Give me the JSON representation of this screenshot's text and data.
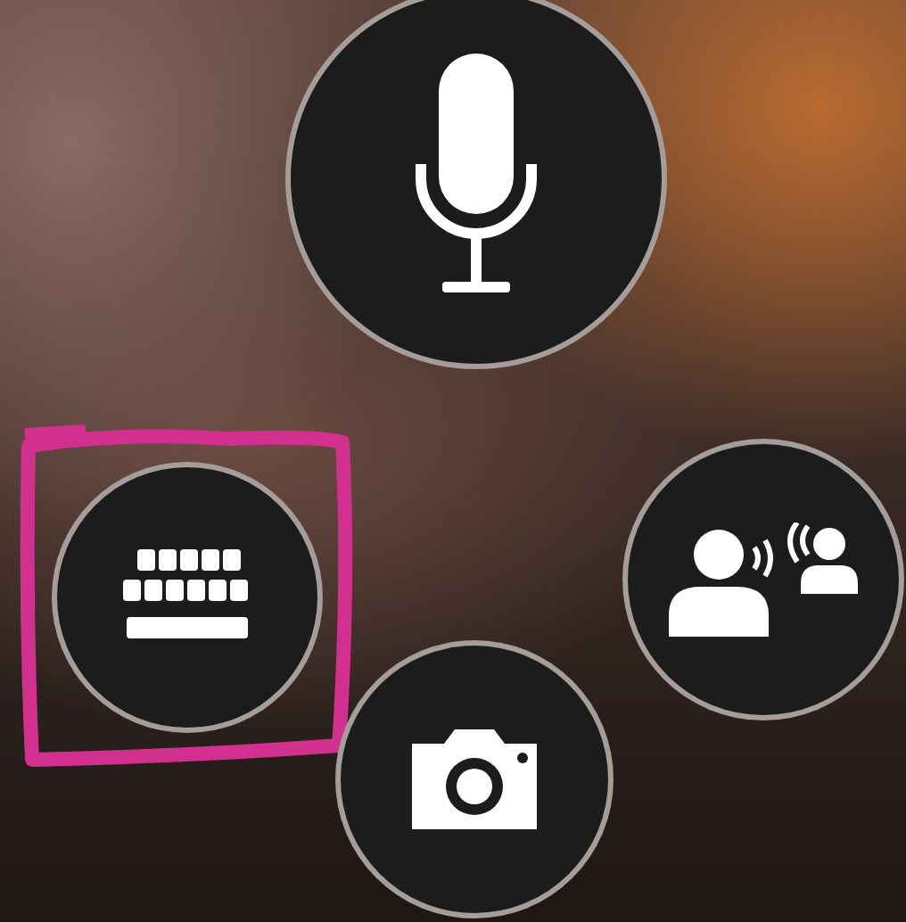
{
  "input_modes": [
    {
      "kind": "microphone",
      "highlighted": false
    },
    {
      "kind": "keyboard",
      "highlighted": true
    },
    {
      "kind": "conversation",
      "highlighted": false
    },
    {
      "kind": "camera",
      "highlighted": false
    }
  ]
}
